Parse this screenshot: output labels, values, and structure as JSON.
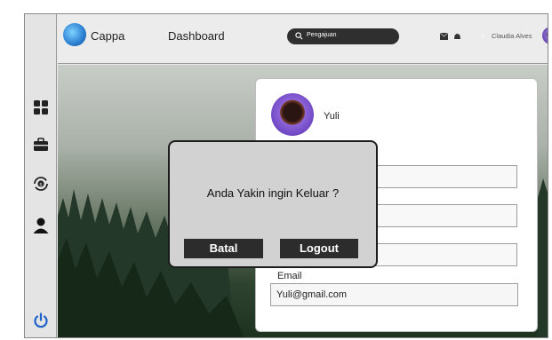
{
  "header": {
    "brand": "Cappa",
    "nav_title": "Dashboard",
    "search_text": "Pengajuan",
    "username": "Claudia Alves"
  },
  "profile": {
    "name": "Yuli",
    "email_label": "Email",
    "email_value": "Yuli@gmail.com"
  },
  "modal": {
    "message": "Anda Yakin ingin Keluar ?",
    "cancel_label": "Batal",
    "logout_label": "Logout"
  },
  "colors": {
    "dark": "#2c2c2c",
    "logout_accent": "#1f62c9"
  },
  "icons": {
    "sidebar": [
      "grid-icon",
      "briefcase-icon",
      "refresh-money-icon",
      "user-icon",
      "power-icon"
    ]
  }
}
